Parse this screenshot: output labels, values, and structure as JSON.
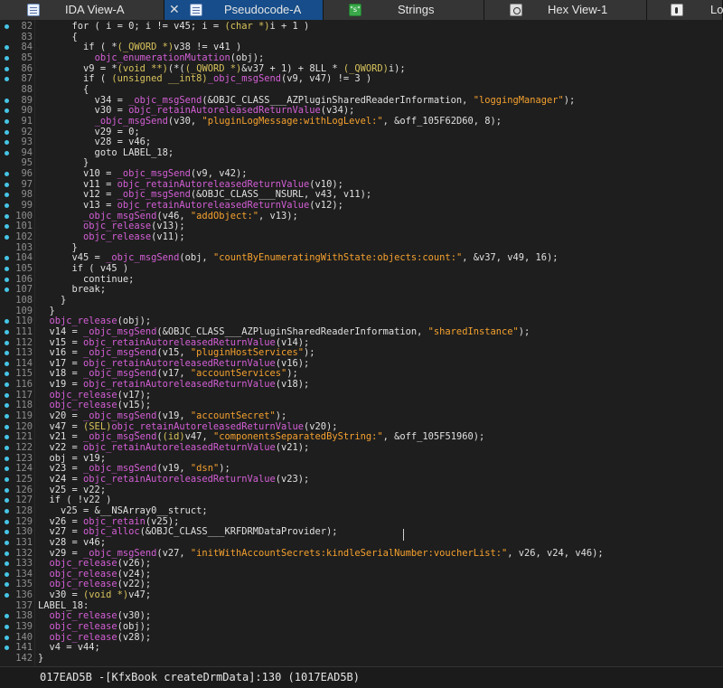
{
  "tabs": [
    {
      "label": "IDA View-A",
      "icon": "ida-view-icon",
      "active": false
    },
    {
      "label": "Pseudocode-A",
      "icon": "pseudocode-icon",
      "active": true,
      "close": "✕"
    },
    {
      "label": "Strings",
      "icon": "strings-icon",
      "active": false,
      "icon_text": "\"s\""
    },
    {
      "label": "Hex View-1",
      "icon": "hex-view-icon",
      "active": false
    },
    {
      "label": "Lo",
      "icon": "locals-icon",
      "active": false
    }
  ],
  "colors": {
    "background": "#1e1e1e",
    "active_tab": "#164d8a",
    "breakpoint_dot": "#46c5e6",
    "function_call": "#d45fd6",
    "string_literal": "#f5a12e",
    "type_cast": "#d8c35c"
  },
  "code": [
    {
      "num": "82",
      "dot": true,
      "text": "      for ( i = 0; i != v45; i = (char *)i + 1 )"
    },
    {
      "num": "83",
      "dot": false,
      "text": "      {"
    },
    {
      "num": "84",
      "dot": true,
      "text": "        if ( *(_QWORD *)v38 != v41 )"
    },
    {
      "num": "85",
      "dot": true,
      "text": "          objc_enumerationMutation(obj);"
    },
    {
      "num": "86",
      "dot": true,
      "text": "        v9 = *(void **)(*((_QWORD *)&v37 + 1) + 8LL * (_QWORD)i);"
    },
    {
      "num": "87",
      "dot": true,
      "text": "        if ( (unsigned __int8)_objc_msgSend(v9, v47) != 3 )"
    },
    {
      "num": "88",
      "dot": false,
      "text": "        {"
    },
    {
      "num": "89",
      "dot": true,
      "text": "          v34 = _objc_msgSend(&OBJC_CLASS___AZPluginSharedReaderInformation, \"loggingManager\");"
    },
    {
      "num": "90",
      "dot": true,
      "text": "          v30 = objc_retainAutoreleasedReturnValue(v34);"
    },
    {
      "num": "91",
      "dot": true,
      "text": "          _objc_msgSend(v30, \"pluginLogMessage:withLogLevel:\", &off_105F62D60, 8);"
    },
    {
      "num": "92",
      "dot": true,
      "text": "          v29 = 0;"
    },
    {
      "num": "93",
      "dot": true,
      "text": "          v28 = v46;"
    },
    {
      "num": "94",
      "dot": true,
      "text": "          goto LABEL_18;"
    },
    {
      "num": "95",
      "dot": false,
      "text": "        }"
    },
    {
      "num": "96",
      "dot": true,
      "text": "        v10 = _objc_msgSend(v9, v42);"
    },
    {
      "num": "97",
      "dot": true,
      "text": "        v11 = objc_retainAutoreleasedReturnValue(v10);"
    },
    {
      "num": "98",
      "dot": true,
      "text": "        v12 = _objc_msgSend(&OBJC_CLASS___NSURL, v43, v11);"
    },
    {
      "num": "99",
      "dot": true,
      "text": "        v13 = objc_retainAutoreleasedReturnValue(v12);"
    },
    {
      "num": "100",
      "dot": true,
      "text": "        _objc_msgSend(v46, \"addObject:\", v13);"
    },
    {
      "num": "101",
      "dot": true,
      "text": "        objc_release(v13);"
    },
    {
      "num": "102",
      "dot": true,
      "text": "        objc_release(v11);"
    },
    {
      "num": "103",
      "dot": false,
      "text": "      }"
    },
    {
      "num": "104",
      "dot": true,
      "text": "      v45 = _objc_msgSend(obj, \"countByEnumeratingWithState:objects:count:\", &v37, v49, 16);"
    },
    {
      "num": "105",
      "dot": true,
      "text": "      if ( v45 )"
    },
    {
      "num": "106",
      "dot": true,
      "text": "        continue;"
    },
    {
      "num": "107",
      "dot": true,
      "text": "      break;"
    },
    {
      "num": "108",
      "dot": false,
      "text": "    }"
    },
    {
      "num": "109",
      "dot": false,
      "text": "  }"
    },
    {
      "num": "110",
      "dot": true,
      "text": "  objc_release(obj);"
    },
    {
      "num": "111",
      "dot": true,
      "text": "  v14 = _objc_msgSend(&OBJC_CLASS___AZPluginSharedReaderInformation, \"sharedInstance\");"
    },
    {
      "num": "112",
      "dot": true,
      "text": "  v15 = objc_retainAutoreleasedReturnValue(v14);"
    },
    {
      "num": "113",
      "dot": true,
      "text": "  v16 = _objc_msgSend(v15, \"pluginHostServices\");"
    },
    {
      "num": "114",
      "dot": true,
      "text": "  v17 = objc_retainAutoreleasedReturnValue(v16);"
    },
    {
      "num": "115",
      "dot": true,
      "text": "  v18 = _objc_msgSend(v17, \"accountServices\");"
    },
    {
      "num": "116",
      "dot": true,
      "text": "  v19 = objc_retainAutoreleasedReturnValue(v18);"
    },
    {
      "num": "117",
      "dot": true,
      "text": "  objc_release(v17);"
    },
    {
      "num": "118",
      "dot": true,
      "text": "  objc_release(v15);"
    },
    {
      "num": "119",
      "dot": true,
      "text": "  v20 = _objc_msgSend(v19, \"accountSecret\");"
    },
    {
      "num": "120",
      "dot": true,
      "text": "  v47 = (SEL)objc_retainAutoreleasedReturnValue(v20);"
    },
    {
      "num": "121",
      "dot": true,
      "text": "  v21 = _objc_msgSend((id)v47, \"componentsSeparatedByString:\", &off_105F51960);"
    },
    {
      "num": "122",
      "dot": true,
      "text": "  v22 = objc_retainAutoreleasedReturnValue(v21);"
    },
    {
      "num": "123",
      "dot": true,
      "text": "  obj = v19;"
    },
    {
      "num": "124",
      "dot": true,
      "text": "  v23 = _objc_msgSend(v19, \"dsn\");"
    },
    {
      "num": "125",
      "dot": true,
      "text": "  v24 = objc_retainAutoreleasedReturnValue(v23);"
    },
    {
      "num": "126",
      "dot": true,
      "text": "  v25 = v22;"
    },
    {
      "num": "127",
      "dot": true,
      "text": "  if ( !v22 )"
    },
    {
      "num": "128",
      "dot": true,
      "text": "    v25 = &__NSArray0__struct;"
    },
    {
      "num": "129",
      "dot": true,
      "text": "  v26 = objc_retain(v25);"
    },
    {
      "num": "130",
      "dot": true,
      "text": "  v27 = objc_alloc(&OBJC_CLASS___KRFDRMDataProvider);"
    },
    {
      "num": "131",
      "dot": true,
      "text": "  v28 = v46;"
    },
    {
      "num": "132",
      "dot": true,
      "text": "  v29 = _objc_msgSend(v27, \"initWithAccountSecrets:kindleSerialNumber:voucherList:\", v26, v24, v46);"
    },
    {
      "num": "133",
      "dot": true,
      "text": "  objc_release(v26);"
    },
    {
      "num": "134",
      "dot": true,
      "text": "  objc_release(v24);"
    },
    {
      "num": "135",
      "dot": true,
      "text": "  objc_release(v22);"
    },
    {
      "num": "136",
      "dot": true,
      "text": "  v30 = (void *)v47;"
    },
    {
      "num": "137",
      "dot": false,
      "text": "LABEL_18:"
    },
    {
      "num": "138",
      "dot": true,
      "text": "  objc_release(v30);"
    },
    {
      "num": "139",
      "dot": true,
      "text": "  objc_release(obj);"
    },
    {
      "num": "140",
      "dot": true,
      "text": "  objc_release(v28);"
    },
    {
      "num": "141",
      "dot": true,
      "text": "  v4 = v44;"
    },
    {
      "num": "142",
      "dot": false,
      "text": "}"
    }
  ],
  "status_text": "017EAD5B -[KfxBook createDrmData]:130 (1017EAD5B)"
}
